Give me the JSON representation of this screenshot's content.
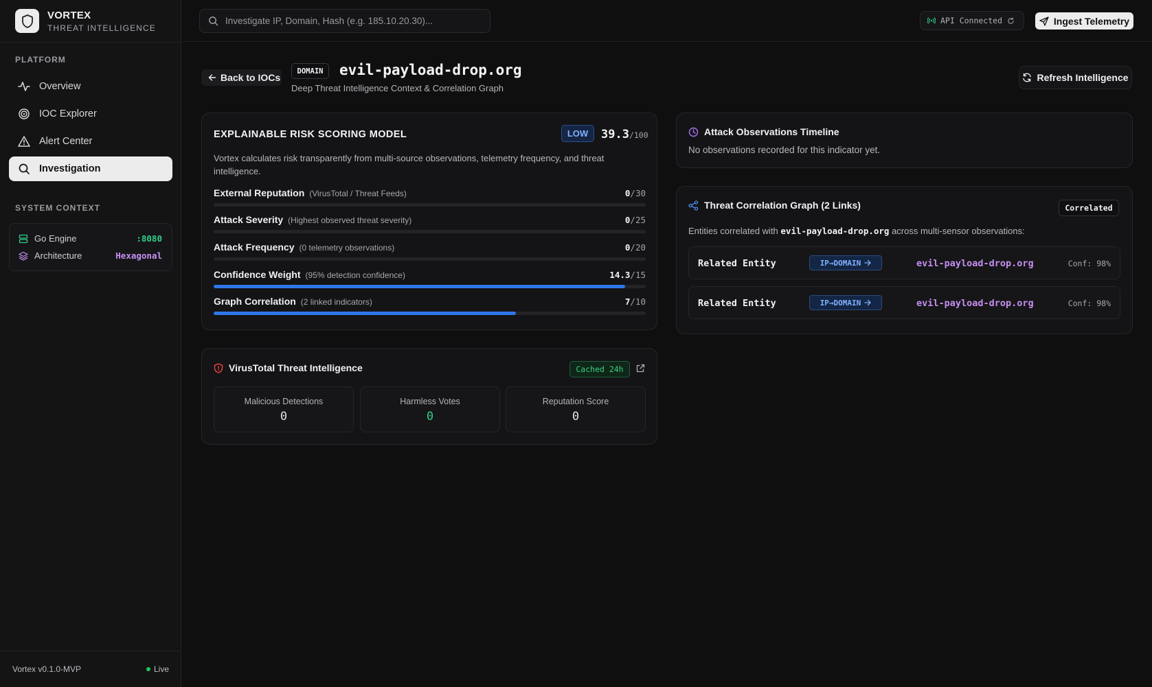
{
  "brand": {
    "name": "VORTEX",
    "tagline": "THREAT INTELLIGENCE"
  },
  "sidebar": {
    "platform_label": "PLATFORM",
    "items": [
      {
        "label": "Overview",
        "icon": "activity-icon"
      },
      {
        "label": "IOC Explorer",
        "icon": "target-icon"
      },
      {
        "label": "Alert Center",
        "icon": "alert-triangle-icon"
      },
      {
        "label": "Investigation",
        "icon": "search-icon",
        "active": true
      }
    ],
    "context_label": "SYSTEM CONTEXT",
    "context": [
      {
        "label": "Go Engine",
        "value": ":8080",
        "color": "#2fd08a"
      },
      {
        "label": "Architecture",
        "value": "Hexagonal",
        "color": "#c58ff2"
      }
    ],
    "footer": {
      "version": "Vortex v0.1.0-MVP",
      "status": "Live"
    }
  },
  "topbar": {
    "search_placeholder": "Investigate IP, Domain, Hash (e.g. 185.10.20.30)...",
    "api_status": "API Connected",
    "ingest_label": "Ingest Telemetry"
  },
  "header": {
    "back_label": "Back to IOCs",
    "type_badge": "DOMAIN",
    "title": "evil-payload-drop.org",
    "subtitle": "Deep Threat Intelligence Context & Correlation Graph",
    "refresh_label": "Refresh Intelligence"
  },
  "risk": {
    "title": "EXPLAINABLE RISK SCORING MODEL",
    "level": "LOW",
    "score": "39.3",
    "score_max": "/100",
    "description": "Vortex calculates risk transparently from multi-source observations, telemetry frequency, and threat intelligence.",
    "metrics": [
      {
        "name": "External Reputation",
        "note": "(VirusTotal / Threat Feeds)",
        "value": "0",
        "max": "/30",
        "fill": 0
      },
      {
        "name": "Attack Severity",
        "note": "(Highest observed threat severity)",
        "value": "0",
        "max": "/25",
        "fill": 0
      },
      {
        "name": "Attack Frequency",
        "note": "(0 telemetry observations)",
        "value": "0",
        "max": "/20",
        "fill": 0
      },
      {
        "name": "Confidence Weight",
        "note": "(95% detection confidence)",
        "value": "14.3",
        "max": "/15",
        "fill": 0.953
      },
      {
        "name": "Graph Correlation",
        "note": "(2 linked indicators)",
        "value": "7",
        "max": "/10",
        "fill": 0.7
      }
    ]
  },
  "virustotal": {
    "title": "VirusTotal Threat Intelligence",
    "cache_badge": "Cached 24h",
    "stats": [
      {
        "label": "Malicious Detections",
        "value": "0"
      },
      {
        "label": "Harmless Votes",
        "value": "0"
      },
      {
        "label": "Reputation Score",
        "value": "0"
      }
    ]
  },
  "timeline": {
    "title": "Attack Observations Timeline",
    "empty_text": "No observations recorded for this indicator yet."
  },
  "graph": {
    "title": "Threat Correlation Graph (2 Links)",
    "badge": "Correlated",
    "desc_prefix": "Entities correlated with",
    "desc_entity": "evil-payload-drop.org",
    "desc_suffix": "across multi-sensor observations:",
    "links": [
      {
        "name": "Related Entity",
        "type": "IP→DOMAIN",
        "target": "evil-payload-drop.org",
        "confidence": "Conf: 98%"
      },
      {
        "name": "Related Entity",
        "type": "IP→DOMAIN",
        "target": "evil-payload-drop.org",
        "confidence": "Conf: 98%"
      }
    ]
  }
}
